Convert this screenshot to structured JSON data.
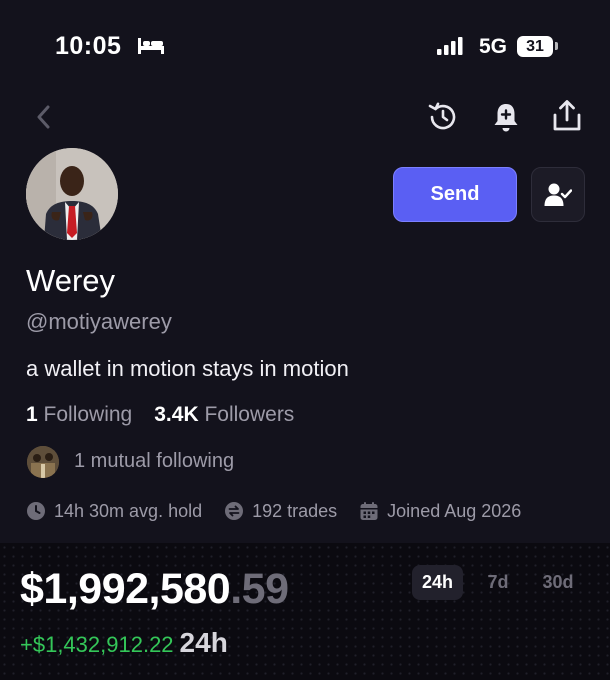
{
  "status_bar": {
    "time": "10:05",
    "network": "5G",
    "battery": "31"
  },
  "nav": {
    "back_icon": "chevron-left-icon",
    "history_icon": "history-icon",
    "bell_icon": "bell-plus-icon",
    "share_icon": "share-icon"
  },
  "profile": {
    "display_name": "Werey",
    "handle": "@motiyawerey",
    "bio": "a wallet in motion stays in motion",
    "following_count": "1",
    "following_label": "Following",
    "followers_count": "3.4K",
    "followers_label": "Followers",
    "mutual_text": "1 mutual following",
    "send_label": "Send",
    "avg_hold": "14h 30m avg. hold",
    "trades": "192 trades",
    "joined": "Joined Aug 2026"
  },
  "balance": {
    "whole": "$1,992,580",
    "cents": ".59",
    "change": "+$1,432,912.22",
    "change_period": "24h",
    "ranges": [
      "24h",
      "7d",
      "30d"
    ],
    "selected_range": "24h"
  },
  "colors": {
    "background": "#13121c",
    "accent": "#5a5ff3",
    "positive": "#34c759",
    "muted": "#9d9ba8"
  }
}
